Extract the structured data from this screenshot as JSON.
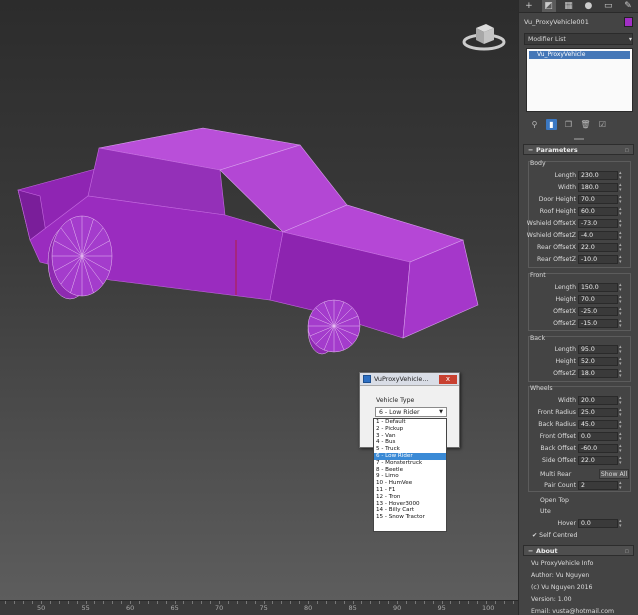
{
  "panel": {
    "object_name": "Vu_ProxyVehicle001",
    "object_color": "#a22fc6",
    "modifier_list": "Modifier List",
    "stack_item": "Vu_ProxyVehicle",
    "tabs": [
      "+",
      "modify-icon",
      "hierarchy-icon",
      "motion-icon",
      "display-icon",
      "utilities-icon"
    ]
  },
  "parameters": {
    "title": "Parameters",
    "body": {
      "title": "Body",
      "fields": [
        {
          "label": "Length",
          "value": "230.0"
        },
        {
          "label": "Width",
          "value": "180.0"
        },
        {
          "label": "Door Height",
          "value": "70.0"
        },
        {
          "label": "Roof Height",
          "value": "60.0"
        },
        {
          "label": "Wshield OffsetX",
          "value": "-73.0"
        },
        {
          "label": "Wshield OffsetZ",
          "value": "-4.0"
        },
        {
          "label": "Rear OffsetX",
          "value": "22.0"
        },
        {
          "label": "Rear OffsetZ",
          "value": "-10.0"
        }
      ]
    },
    "front": {
      "title": "Front",
      "fields": [
        {
          "label": "Length",
          "value": "150.0"
        },
        {
          "label": "Height",
          "value": "70.0"
        },
        {
          "label": "OffsetX",
          "value": "-25.0"
        },
        {
          "label": "OffsetZ",
          "value": "-15.0"
        }
      ]
    },
    "back": {
      "title": "Back",
      "fields": [
        {
          "label": "Length",
          "value": "95.0"
        },
        {
          "label": "Height",
          "value": "52.0"
        },
        {
          "label": "OffsetZ",
          "value": "18.0"
        }
      ]
    },
    "wheels": {
      "title": "Wheels",
      "fields": [
        {
          "label": "Width",
          "value": "20.0"
        },
        {
          "label": "Front Radius",
          "value": "25.0"
        },
        {
          "label": "Back Radius",
          "value": "45.0"
        },
        {
          "label": "Front Offset",
          "value": "0.0"
        },
        {
          "label": "Back Offset",
          "value": "-60.0"
        },
        {
          "label": "Side Offset",
          "value": "22.0"
        }
      ],
      "multi_rear": "Multi Rear",
      "show_all": "Show All",
      "pair_count_label": "Pair Count",
      "pair_count": "2"
    },
    "open_top": "Open Top",
    "ute": "Ute",
    "hover_label": "Hover",
    "hover_value": "0.0",
    "self_centred": "Self Centred",
    "self_centred_checked": true
  },
  "about": {
    "title": "About",
    "lines": [
      "Vu ProxyVehicle Info",
      "Author: Vu Nguyen",
      "(c) Vu Nguyen 2016",
      "Version: 1.00",
      "Email: vusta@hotmail.com"
    ]
  },
  "dialog": {
    "title": "VuProxyVehicle...",
    "close": "x",
    "vehicle_type_label": "Vehicle Type",
    "selected": "6 - Low Rider",
    "options": [
      "1 - Default",
      "2 - Pickup",
      "3 - Van",
      "4 - Bus",
      "5 - Truck",
      "6 - Low Rider",
      "7 - Monstertruck",
      "8 - Beetle",
      "9 - Limo",
      "10 - HumVee",
      "11 - F1",
      "12 - Tron",
      "13 - Hover3000",
      "14 - Billy Cart",
      "15 - Snow Tractor"
    ],
    "selected_index": 5
  },
  "timeline": {
    "labels": [
      "50",
      "55",
      "60",
      "65",
      "70",
      "75",
      "80",
      "85",
      "90",
      "95",
      "100"
    ]
  },
  "colors": {
    "car_body": "#a22fc6",
    "selection_blue": "#3a8ad6"
  }
}
